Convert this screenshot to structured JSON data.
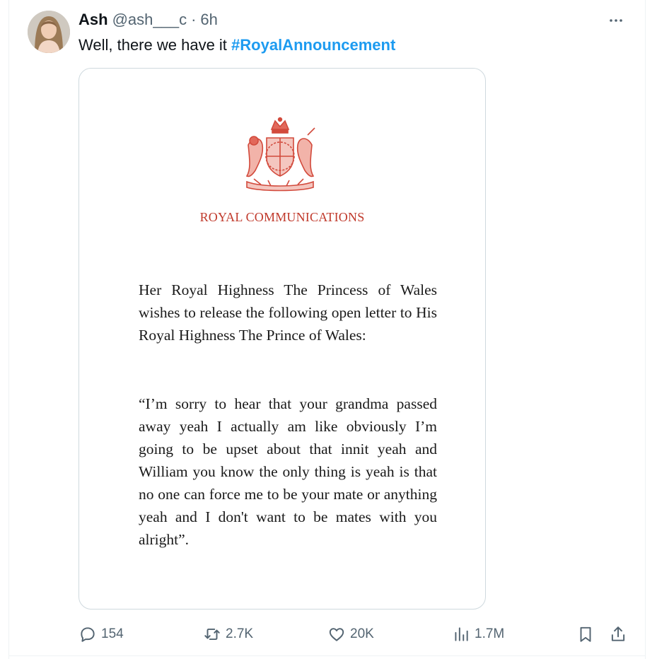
{
  "tweet": {
    "author_name": "Ash",
    "handle": "@ash___c",
    "separator": "·",
    "time": "6h",
    "text_plain": "Well, there we have it ",
    "hashtag": "#RoyalAnnouncement",
    "more_icon": "more-horizontal-icon"
  },
  "media": {
    "crest_icon": "royal-coat-of-arms-icon",
    "org_title": "ROYAL COMMUNICATIONS",
    "paragraph_1": "Her Royal Highness The Princess of Wales wishes to release the following open letter to His Royal Highness The Prince of Wales:",
    "paragraph_2": "“I’m sorry to hear that your grandma passed away yeah I actually am like obviously I’m going to be upset about that innit yeah and William you know the only thing is yeah is that no one can force me to be your mate or anything yeah and I don't want to be mates with you alright”.",
    "accent_color": "#c0392b"
  },
  "actions": {
    "replies": "154",
    "reposts": "2.7K",
    "likes": "20K",
    "views": "1.7M",
    "reply_icon": "reply-icon",
    "repost_icon": "repost-icon",
    "like_icon": "heart-icon",
    "views_icon": "bar-chart-icon",
    "bookmark_icon": "bookmark-icon",
    "share_icon": "share-icon"
  },
  "colors": {
    "link": "#1d9bf0",
    "secondary_text": "#536471",
    "primary_text": "#0f1419"
  }
}
